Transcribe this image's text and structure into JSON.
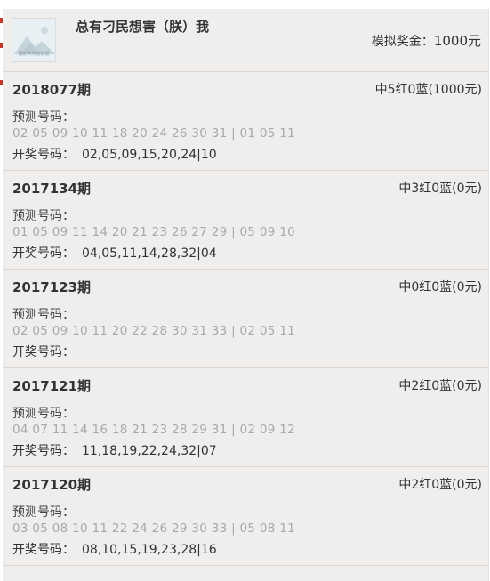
{
  "header": {
    "username": "总有刁民想害（朕）我",
    "prize_label": "模拟奖金：",
    "prize_amount": "1000元",
    "avatar_caption": "福彩大乐透数据"
  },
  "labels": {
    "prediction": "预测号码：",
    "draw": "开奖号码："
  },
  "records": [
    {
      "issue": "2018077期",
      "result": "中5红0蓝(1000元)",
      "prediction": "02 05 09 10 11 18 20 24 26 30 31 | 01 05 11",
      "draw": "02,05,09,15,20,24|10"
    },
    {
      "issue": "2017134期",
      "result": "中3红0蓝(0元)",
      "prediction": "01 05 09 11 14 20 21 23 26 27 29 | 05 09 10",
      "draw": "04,05,11,14,28,32|04"
    },
    {
      "issue": "2017123期",
      "result": "中0红0蓝(0元)",
      "prediction": "02 05 09 10 11 20 22 28 30 31 33 | 02 05 11",
      "draw": ""
    },
    {
      "issue": "2017121期",
      "result": "中2红0蓝(0元)",
      "prediction": "04 07 11 14 16 18 21 23 28 29 31 | 02 09 12",
      "draw": "11,18,19,22,24,32|07"
    },
    {
      "issue": "2017120期",
      "result": "中2红0蓝(0元)",
      "prediction": "03 05 08 10 11 22 24 26 29 30 33 | 05 08 11",
      "draw": "08,10,15,19,23,28|16"
    }
  ]
}
